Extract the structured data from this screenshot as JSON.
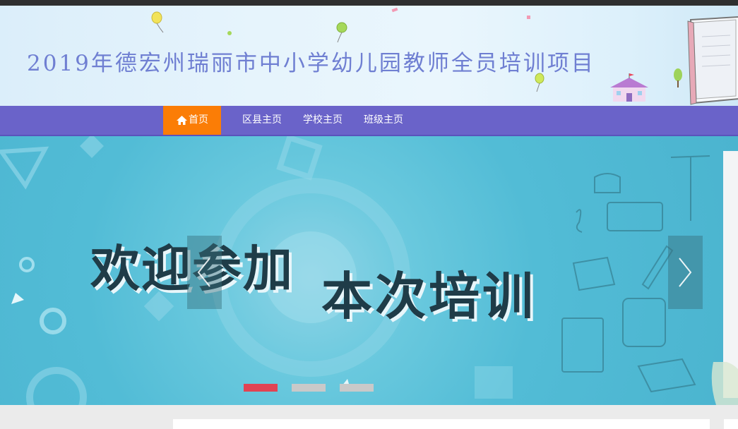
{
  "header": {
    "title": "2019年德宏州瑞丽市中小学幼儿园教师全员培训项目"
  },
  "nav": {
    "items": [
      {
        "label": "首页",
        "icon": "home-icon",
        "active": true
      },
      {
        "label": "区县主页"
      },
      {
        "label": "学校主页"
      },
      {
        "label": "班级主页"
      }
    ]
  },
  "banner": {
    "line1": "欢迎参加",
    "line2": "本次培训",
    "prev_icon": "chevron-left-icon",
    "next_icon": "chevron-right-icon",
    "slide_count": 3,
    "active_slide": 1
  },
  "colors": {
    "nav_bg": "#6a63c9",
    "nav_active": "#fb7d06",
    "title_text": "#6f7fd2",
    "banner_bg": "#52bcd6",
    "dot_active": "#e14353",
    "dot_inactive": "#c9c9c9"
  }
}
